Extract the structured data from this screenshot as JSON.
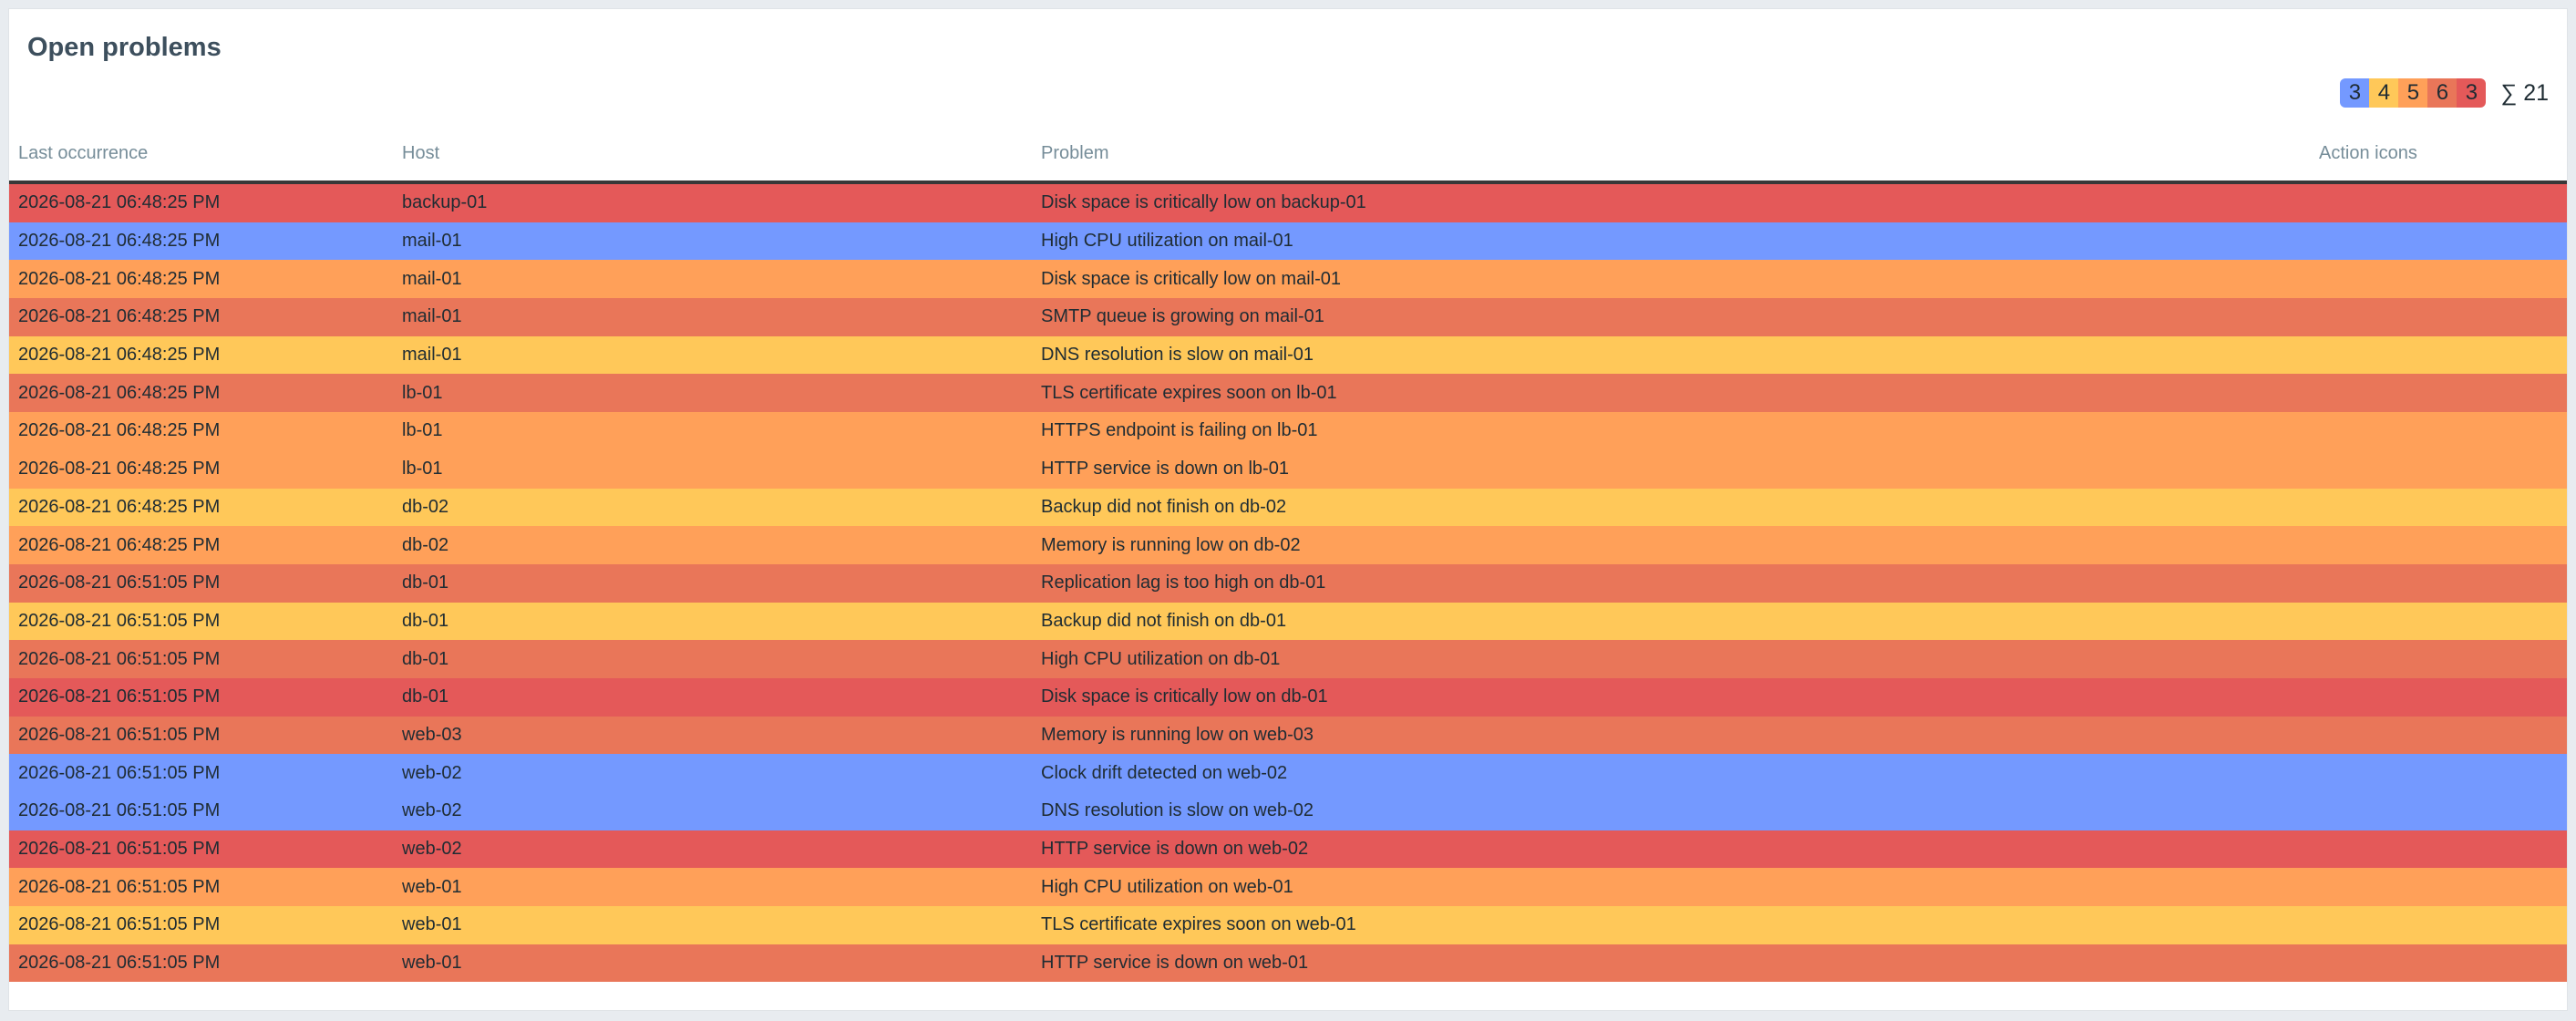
{
  "widget": {
    "title": "Open problems"
  },
  "severity_summary": {
    "segments": [
      {
        "count": "3",
        "color": "#7499ff"
      },
      {
        "count": "4",
        "color": "#ffc859"
      },
      {
        "count": "5",
        "color": "#ffa059"
      },
      {
        "count": "6",
        "color": "#e97659"
      },
      {
        "count": "3",
        "color": "#e45959"
      }
    ],
    "total_label": "∑ 21"
  },
  "table": {
    "columns": [
      "Last occurrence",
      "Host",
      "Problem",
      "Action icons"
    ],
    "rows": [
      {
        "time": "2026-08-21 06:48:25 PM",
        "host": "backup-01",
        "problem": "Disk space is critically low on backup-01",
        "color": "#e45959"
      },
      {
        "time": "2026-08-21 06:48:25 PM",
        "host": "mail-01",
        "problem": "High CPU utilization on mail-01",
        "color": "#7499ff"
      },
      {
        "time": "2026-08-21 06:48:25 PM",
        "host": "mail-01",
        "problem": "Disk space is critically low on mail-01",
        "color": "#ffa059"
      },
      {
        "time": "2026-08-21 06:48:25 PM",
        "host": "mail-01",
        "problem": "SMTP queue is growing on mail-01",
        "color": "#e97659"
      },
      {
        "time": "2026-08-21 06:48:25 PM",
        "host": "mail-01",
        "problem": "DNS resolution is slow on mail-01",
        "color": "#ffc859"
      },
      {
        "time": "2026-08-21 06:48:25 PM",
        "host": "lb-01",
        "problem": "TLS certificate expires soon on lb-01",
        "color": "#e97659"
      },
      {
        "time": "2026-08-21 06:48:25 PM",
        "host": "lb-01",
        "problem": "HTTPS endpoint is failing on lb-01",
        "color": "#ffa059"
      },
      {
        "time": "2026-08-21 06:48:25 PM",
        "host": "lb-01",
        "problem": "HTTP service is down on lb-01",
        "color": "#ffa059"
      },
      {
        "time": "2026-08-21 06:48:25 PM",
        "host": "db-02",
        "problem": "Backup did not finish on db-02",
        "color": "#ffc859"
      },
      {
        "time": "2026-08-21 06:48:25 PM",
        "host": "db-02",
        "problem": "Memory is running low on db-02",
        "color": "#ffa059"
      },
      {
        "time": "2026-08-21 06:51:05 PM",
        "host": "db-01",
        "problem": "Replication lag is too high on db-01",
        "color": "#e97659"
      },
      {
        "time": "2026-08-21 06:51:05 PM",
        "host": "db-01",
        "problem": "Backup did not finish on db-01",
        "color": "#ffc859"
      },
      {
        "time": "2026-08-21 06:51:05 PM",
        "host": "db-01",
        "problem": "High CPU utilization on db-01",
        "color": "#e97659"
      },
      {
        "time": "2026-08-21 06:51:05 PM",
        "host": "db-01",
        "problem": "Disk space is critically low on db-01",
        "color": "#e45959"
      },
      {
        "time": "2026-08-21 06:51:05 PM",
        "host": "web-03",
        "problem": "Memory is running low on web-03",
        "color": "#e97659"
      },
      {
        "time": "2026-08-21 06:51:05 PM",
        "host": "web-02",
        "problem": "Clock drift detected on web-02",
        "color": "#7499ff"
      },
      {
        "time": "2026-08-21 06:51:05 PM",
        "host": "web-02",
        "problem": "DNS resolution is slow on web-02",
        "color": "#7499ff"
      },
      {
        "time": "2026-08-21 06:51:05 PM",
        "host": "web-02",
        "problem": "HTTP service is down on web-02",
        "color": "#e45959"
      },
      {
        "time": "2026-08-21 06:51:05 PM",
        "host": "web-01",
        "problem": "High CPU utilization on web-01",
        "color": "#ffa059"
      },
      {
        "time": "2026-08-21 06:51:05 PM",
        "host": "web-01",
        "problem": "TLS certificate expires soon on web-01",
        "color": "#ffc859"
      },
      {
        "time": "2026-08-21 06:51:05 PM",
        "host": "web-01",
        "problem": "HTTP service is down on web-01",
        "color": "#e97659"
      }
    ]
  }
}
